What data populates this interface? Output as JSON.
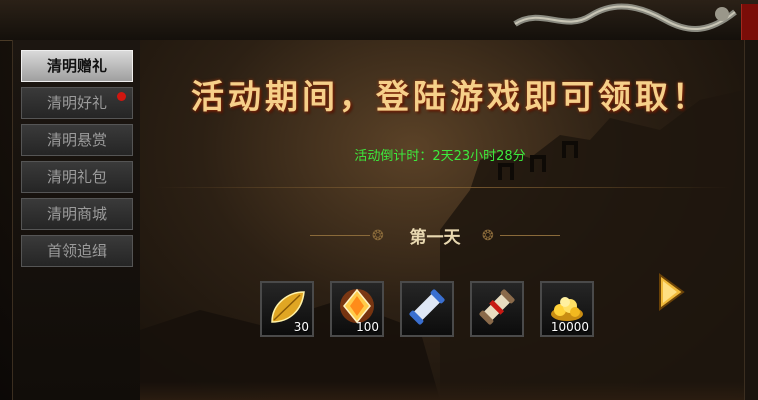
{
  "sidebar": {
    "items": [
      {
        "label": "清明赠礼",
        "active": true
      },
      {
        "label": "清明好礼",
        "badge": true
      },
      {
        "label": "清明悬赏"
      },
      {
        "label": "清明礼包"
      },
      {
        "label": "清明商城"
      },
      {
        "label": "首领追缉"
      }
    ]
  },
  "main": {
    "headline": "活动期间，登陆游戏即可领取！",
    "countdown": "活动倒计时：2天23小时28分",
    "day_title": "第一天",
    "rewards": [
      {
        "icon": "gold-leaf-icon",
        "count": "30"
      },
      {
        "icon": "crystal-gem-icon",
        "count": "100"
      },
      {
        "icon": "blue-scroll-icon",
        "count": ""
      },
      {
        "icon": "red-scroll-icon",
        "count": ""
      },
      {
        "icon": "gold-ingot-pile-icon",
        "count": "10000"
      }
    ]
  },
  "colors": {
    "countdown": "#3dea3d",
    "headline": "#f6d08a",
    "badge": "#d0160f"
  }
}
